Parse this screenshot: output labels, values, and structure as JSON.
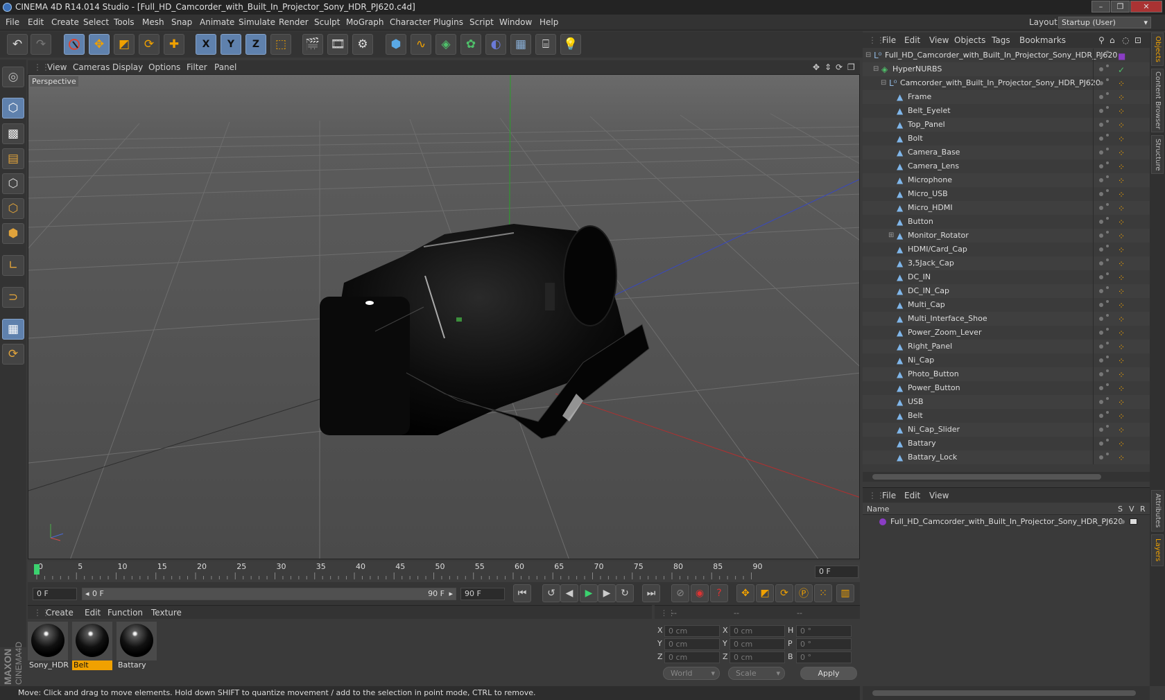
{
  "window": {
    "title": "CINEMA 4D R14.014 Studio - [Full_HD_Camcorder_with_Built_In_Projector_Sony_HDR_PJ620.c4d]",
    "controls": [
      "–",
      "❐",
      "✕"
    ]
  },
  "menubar": {
    "items": [
      "File",
      "Edit",
      "Create",
      "Select",
      "Tools",
      "Mesh",
      "Snap",
      "Animate",
      "Simulate",
      "Render",
      "Sculpt",
      "MoGraph",
      "Character",
      "Plugins",
      "Script",
      "Window",
      "Help"
    ],
    "layout_label": "Layout:",
    "layout_value": "Startup (User)"
  },
  "toolbar": {
    "tools": [
      "undo-icon",
      "redo-icon",
      "live-selection-icon",
      "move-icon",
      "scale-icon",
      "rotate-icon",
      "add-icon",
      "x-axis-icon",
      "y-axis-icon",
      "z-axis-icon",
      "world-coords-icon",
      "render-view-icon",
      "render-picture-viewer-icon",
      "render-settings-icon",
      "cube-icon",
      "spline-icon",
      "nurbs-icon",
      "array-icon",
      "deformer-icon",
      "floor-icon",
      "camera-icon",
      "light-icon"
    ],
    "axis_labels": [
      "X",
      "Y",
      "Z"
    ]
  },
  "viewport": {
    "menu": [
      "View",
      "Cameras",
      "Display",
      "Options",
      "Filter",
      "Panel"
    ],
    "label": "Perspective"
  },
  "timeline": {
    "ticks": [
      "0",
      "5",
      "10",
      "15",
      "20",
      "25",
      "30",
      "35",
      "40",
      "45",
      "50",
      "55",
      "60",
      "65",
      "70",
      "75",
      "80",
      "85",
      "90"
    ],
    "current_frame_field": "0 F",
    "start_field": "0 F",
    "range_start": "0 F",
    "range_end": "90 F",
    "end_field": "90 F",
    "end_frame_right": "0 F"
  },
  "materials": {
    "menu": [
      "Create",
      "Edit",
      "Function",
      "Texture"
    ],
    "items": [
      {
        "name": "Sony_HDR",
        "selected": false
      },
      {
        "name": "Belt",
        "selected": true
      },
      {
        "name": "Battary",
        "selected": false
      }
    ]
  },
  "coordinates": {
    "headers": [
      "--",
      "--",
      "--"
    ],
    "rows": [
      {
        "l1": "X",
        "v1": "0 cm",
        "l2": "X",
        "v2": "0 cm",
        "l3": "H",
        "v3": "0 °"
      },
      {
        "l1": "Y",
        "v1": "0 cm",
        "l2": "Y",
        "v2": "0 cm",
        "l3": "P",
        "v3": "0 °"
      },
      {
        "l1": "Z",
        "v1": "0 cm",
        "l2": "Z",
        "v2": "0 cm",
        "l3": "B",
        "v3": "0 °"
      }
    ],
    "mode": "World",
    "transform": "Scale",
    "apply": "Apply"
  },
  "status": "Move: Click and drag to move elements. Hold down SHIFT to quantize movement / add to the selection in point mode, CTRL to remove.",
  "maxon_logo": "MAXON CINEMA4D",
  "object_manager": {
    "menu": [
      "File",
      "Edit",
      "View",
      "Objects",
      "Tags",
      "Bookmarks"
    ],
    "objects": [
      {
        "name": "Full_HD_Camcorder_with_Built_In_Projector_Sony_HDR_PJ620",
        "level": 0,
        "type": "null"
      },
      {
        "name": "HyperNURBS",
        "level": 1,
        "type": "nurbs"
      },
      {
        "name": "Camcorder_with_Built_In_Projector_Sony_HDR_PJ620",
        "level": 2,
        "type": "null"
      },
      {
        "name": "Frame",
        "level": 3,
        "type": "poly"
      },
      {
        "name": "Belt_Eyelet",
        "level": 3,
        "type": "poly"
      },
      {
        "name": "Top_Panel",
        "level": 3,
        "type": "poly"
      },
      {
        "name": "Bolt",
        "level": 3,
        "type": "poly"
      },
      {
        "name": "Camera_Base",
        "level": 3,
        "type": "poly"
      },
      {
        "name": "Camera_Lens",
        "level": 3,
        "type": "poly"
      },
      {
        "name": "Microphone",
        "level": 3,
        "type": "poly"
      },
      {
        "name": "Micro_USB",
        "level": 3,
        "type": "poly"
      },
      {
        "name": "Micro_HDMI",
        "level": 3,
        "type": "poly"
      },
      {
        "name": "Button",
        "level": 3,
        "type": "poly"
      },
      {
        "name": "Monitor_Rotator",
        "level": 3,
        "type": "poly"
      },
      {
        "name": "HDMI/Card_Cap",
        "level": 3,
        "type": "poly"
      },
      {
        "name": "3,5Jack_Cap",
        "level": 3,
        "type": "poly"
      },
      {
        "name": "DC_IN",
        "level": 3,
        "type": "poly"
      },
      {
        "name": "DC_IN_Cap",
        "level": 3,
        "type": "poly"
      },
      {
        "name": "Multi_Cap",
        "level": 3,
        "type": "poly"
      },
      {
        "name": "Multi_Interface_Shoe",
        "level": 3,
        "type": "poly"
      },
      {
        "name": "Power_Zoom_Lever",
        "level": 3,
        "type": "poly"
      },
      {
        "name": "Right_Panel",
        "level": 3,
        "type": "poly"
      },
      {
        "name": "Ni_Cap",
        "level": 3,
        "type": "poly"
      },
      {
        "name": "Photo_Button",
        "level": 3,
        "type": "poly"
      },
      {
        "name": "Power_Button",
        "level": 3,
        "type": "poly"
      },
      {
        "name": "USB",
        "level": 3,
        "type": "poly"
      },
      {
        "name": "Belt",
        "level": 3,
        "type": "poly"
      },
      {
        "name": "Ni_Cap_Slider",
        "level": 3,
        "type": "poly"
      },
      {
        "name": "Battary",
        "level": 3,
        "type": "poly"
      },
      {
        "name": "Battary_Lock",
        "level": 3,
        "type": "poly"
      }
    ]
  },
  "layer_manager": {
    "menu": [
      "File",
      "Edit",
      "View"
    ],
    "columns": [
      "Name",
      "S",
      "V",
      "R"
    ],
    "layers": [
      {
        "name": "Full_HD_Camcorder_with_Built_In_Projector_Sony_HDR_PJ620",
        "color": "#8a3dc4"
      }
    ]
  },
  "right_tabs": [
    "Objects",
    "Content Browser",
    "Structure",
    "Attributes",
    "Layers"
  ],
  "colors": {
    "accent_orange": "#f0a100",
    "selected_blue": "#5f81ad",
    "axis_x": "#b03030",
    "axis_y": "#2fa02f",
    "axis_z": "#3040b0"
  }
}
